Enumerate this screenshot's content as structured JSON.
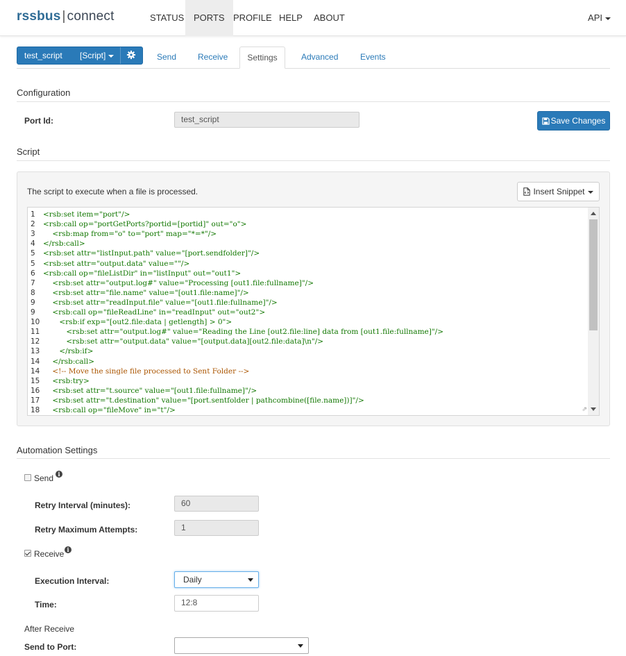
{
  "nav": {
    "logo_brand": "rssbus",
    "logo_sep": "|",
    "logo_product": "connect",
    "items": [
      {
        "label": "STATUS"
      },
      {
        "label": "PORTS"
      },
      {
        "label": "PROFILE"
      },
      {
        "label": "HELP"
      },
      {
        "label": "ABOUT"
      }
    ],
    "active": "PORTS",
    "api_label": "API"
  },
  "port": {
    "name": "test_script",
    "type": "[Script]",
    "tabs": [
      {
        "label": "Send"
      },
      {
        "label": "Receive"
      },
      {
        "label": "Settings"
      },
      {
        "label": "Advanced"
      },
      {
        "label": "Events"
      }
    ],
    "active_tab": "Settings"
  },
  "configuration": {
    "title": "Configuration",
    "port_id_label": "Port Id:",
    "port_id_value": "test_script",
    "save_label": "Save Changes"
  },
  "script": {
    "title": "Script",
    "description": "The script to execute when a file is processed.",
    "snippet_label": "Insert Snippet",
    "lines": [
      {
        "n": "1",
        "text": "<rsb:set item=\"port\"/>",
        "comment": false
      },
      {
        "n": "2",
        "text": "<rsb:call op=\"portGetPorts?portid=[portid]\" out=\"o\">",
        "comment": false
      },
      {
        "n": "3",
        "text": "    <rsb:map from=\"o\" to=\"port\" map=\"*=*\"/>",
        "comment": false
      },
      {
        "n": "4",
        "text": "</rsb:call>",
        "comment": false
      },
      {
        "n": "5",
        "text": "<rsb:set attr=\"listInput.path\" value=\"[port.sendfolder]\"/>",
        "comment": false
      },
      {
        "n": "5",
        "text": "<rsb:set attr=\"output.data\" value=\"\"/>",
        "comment": false
      },
      {
        "n": "6",
        "text": "<rsb:call op=\"fileListDir\" in=\"listInput\" out=\"out1\">",
        "comment": false
      },
      {
        "n": "7",
        "text": "    <rsb:set attr=\"output.log#\" value=\"Processing [out1.file:fullname]\"/>",
        "comment": false
      },
      {
        "n": "8",
        "text": "    <rsb:set attr=\"file.name\" value=\"[out1.file:name]\"/>",
        "comment": false
      },
      {
        "n": "9",
        "text": "    <rsb:set attr=\"readInput.file\" value=\"[out1.file:fullname]\"/>",
        "comment": false
      },
      {
        "n": "9",
        "text": "    <rsb:call op=\"fileReadLine\" in=\"readInput\" out=\"out2\">",
        "comment": false
      },
      {
        "n": "10",
        "text": "       <rsb:if exp=\"[out2.file:data | getlength] > 0\">",
        "comment": false
      },
      {
        "n": "11",
        "text": "          <rsb:set attr=\"output.log#\" value=\"Reading the Line [out2.file:line] data from [out1.file:fullname]\"/>",
        "comment": false
      },
      {
        "n": "12",
        "text": "          <rsb:set attr=\"output.data\" value=\"[output.data][out2.file:data]\\n\"/>",
        "comment": false
      },
      {
        "n": "13",
        "text": "       </rsb:if>",
        "comment": false
      },
      {
        "n": "14",
        "text": "    </rsb:call>",
        "comment": false
      },
      {
        "n": "14",
        "text": "    <!-- Move the single file processed to Sent Folder -->",
        "comment": true
      },
      {
        "n": "15",
        "text": "    <rsb:try>",
        "comment": false
      },
      {
        "n": "16",
        "text": "    <rsb:set attr=\"t.source\" value=\"[out1.file:fullname]\"/>",
        "comment": false
      },
      {
        "n": "17",
        "text": "    <rsb:set attr=\"t.destination\" value=\"[port.sentfolder | pathcombine([file.name])]\"/>",
        "comment": false
      },
      {
        "n": "18",
        "text": "    <rsb:call op=\"fileMove\" in=\"t\"/>",
        "comment": false
      }
    ]
  },
  "automation": {
    "title": "Automation Settings",
    "send": {
      "label": "Send",
      "checked": false,
      "retry_interval_label": "Retry Interval (minutes):",
      "retry_interval_value": "60",
      "retry_max_label": "Retry Maximum Attempts:",
      "retry_max_value": "1"
    },
    "receive": {
      "label": "Receive",
      "checked": true,
      "exec_interval_label": "Execution Interval:",
      "exec_interval_value": "Daily",
      "time_label": "Time:",
      "time_value": "12:8"
    },
    "after_receive_label": "After Receive",
    "send_to_port_label": "Send to Port:",
    "send_to_port_value": ""
  },
  "colors": {
    "accent": "#2a7ab8",
    "code_text": "#117700",
    "code_comment": "#aa5500"
  }
}
